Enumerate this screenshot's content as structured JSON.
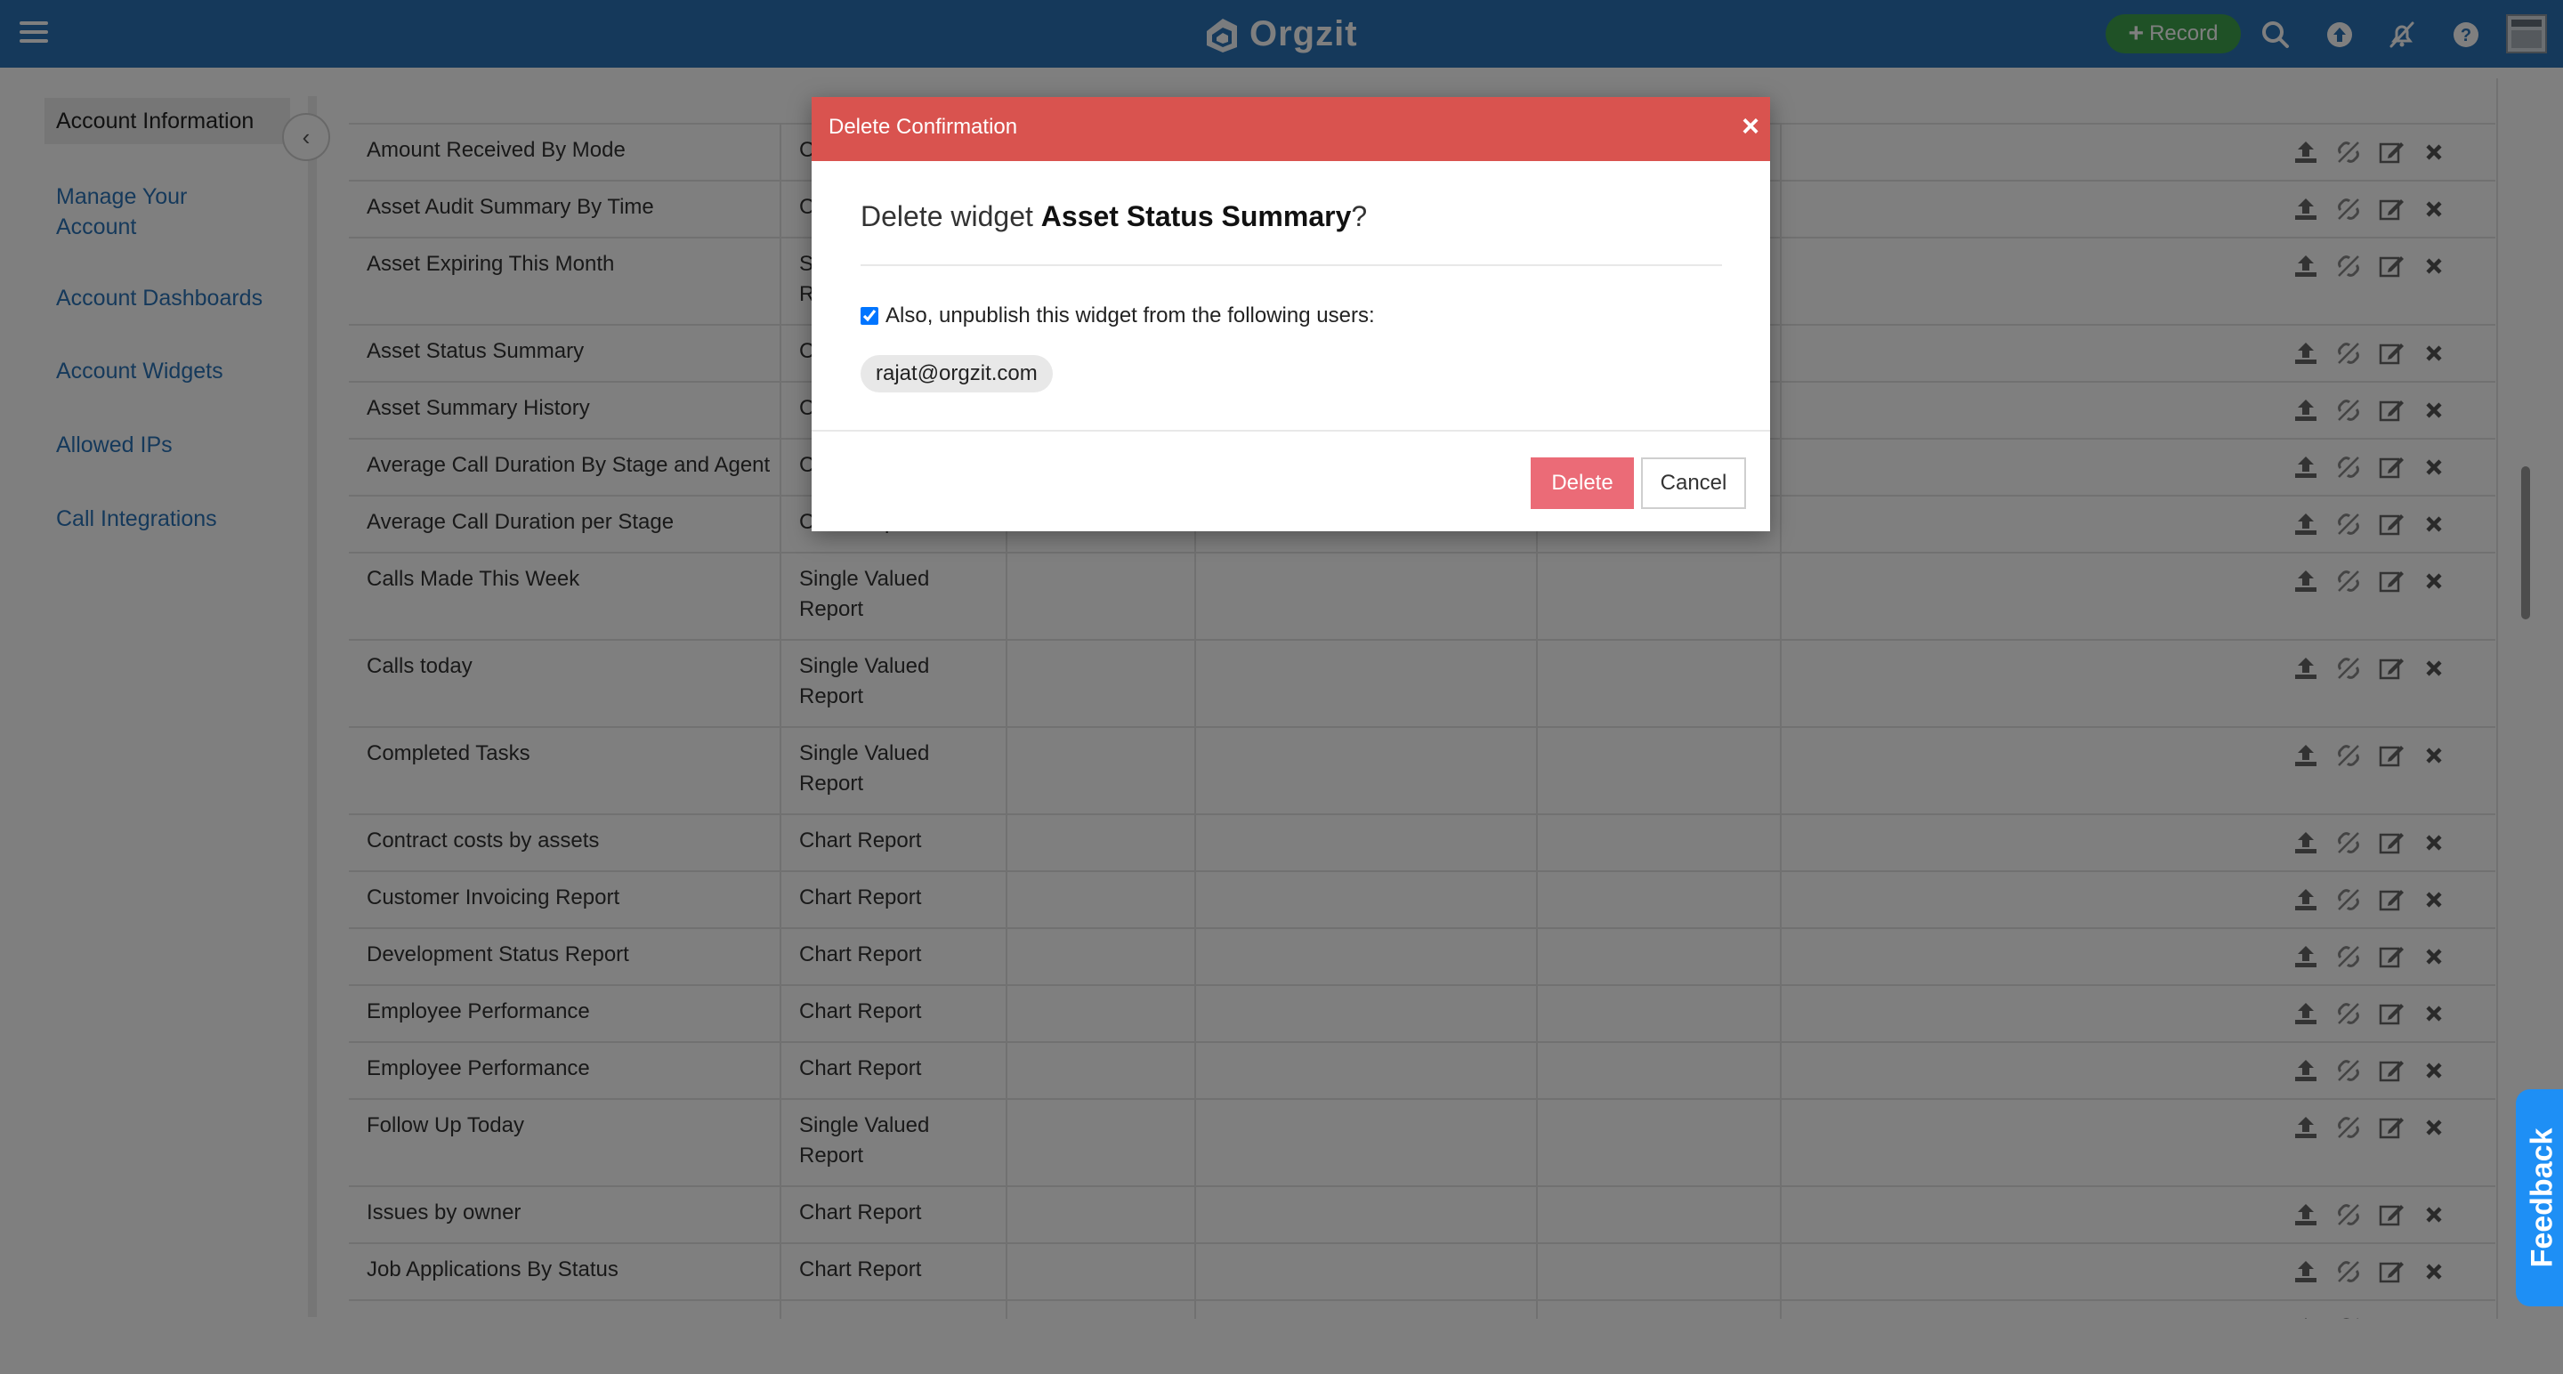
{
  "header": {
    "app_name": "Orgzit",
    "record_button": "Record",
    "colors": {
      "bar": "#2b73b7",
      "record": "#3fa34d"
    },
    "icons": [
      "menu-icon",
      "search-icon",
      "upload-icon",
      "notifications-off-icon",
      "help-icon",
      "avatar"
    ]
  },
  "sidebar": {
    "items": [
      {
        "label": "Account Information",
        "active": true
      },
      {
        "label": "Manage Your Account",
        "active": false
      },
      {
        "label": "Account Dashboards",
        "active": false
      },
      {
        "label": "Account Widgets",
        "active": false
      },
      {
        "label": "Allowed IPs",
        "active": false
      },
      {
        "label": "Call Integrations",
        "active": false
      }
    ]
  },
  "table": {
    "rows": [
      {
        "name": "Amount Received By Mode",
        "type": "Chart Report"
      },
      {
        "name": "Asset Audit Summary By Time",
        "type": "Chart Report"
      },
      {
        "name": "Asset Expiring This Month",
        "type": "Single Valued Report"
      },
      {
        "name": "Asset Status Summary",
        "type": "Chart Report"
      },
      {
        "name": "Asset Summary History",
        "type": "Chart Report"
      },
      {
        "name": "Average Call Duration By Stage and Agent",
        "type": "Chart Report"
      },
      {
        "name": "Average Call Duration per Stage",
        "type": "Chart Report"
      },
      {
        "name": "Calls Made This Week",
        "type": "Single Valued Report"
      },
      {
        "name": "Calls today",
        "type": "Single Valued Report"
      },
      {
        "name": "Completed Tasks",
        "type": "Single Valued Report"
      },
      {
        "name": "Contract costs by assets",
        "type": "Chart Report"
      },
      {
        "name": "Customer Invoicing Report",
        "type": "Chart Report"
      },
      {
        "name": "Development Status Report",
        "type": "Chart Report"
      },
      {
        "name": "Employee Performance",
        "type": "Chart Report"
      },
      {
        "name": "Employee Performance",
        "type": "Chart Report"
      },
      {
        "name": "Follow Up Today",
        "type": "Single Valued Report"
      },
      {
        "name": "Issues by owner",
        "type": "Chart Report"
      },
      {
        "name": "Job Applications By Status",
        "type": "Chart Report"
      }
    ],
    "row_actions": [
      "publish-icon",
      "unlink-icon",
      "edit-icon",
      "delete-icon"
    ]
  },
  "modal": {
    "title": "Delete Confirmation",
    "question_prefix": "Delete widget ",
    "widget_name": "Asset Status Summary",
    "question_suffix": "?",
    "checkbox_label": "Also, unpublish this widget from the following users:",
    "checkbox_checked": true,
    "users": [
      "rajat@orgzit.com"
    ],
    "delete_label": "Delete",
    "cancel_label": "Cancel",
    "header_color": "#d9534f",
    "delete_color": "#eb6b77"
  },
  "feedback": {
    "label": "Feedback",
    "color": "#1e8ff5"
  }
}
